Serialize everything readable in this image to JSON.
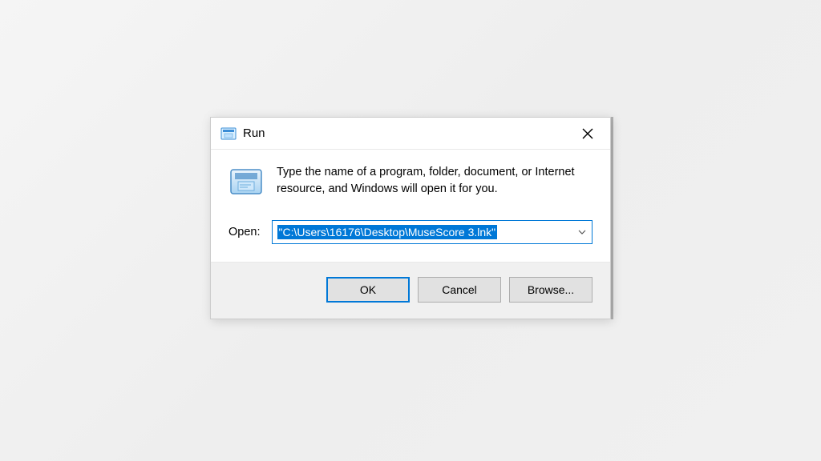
{
  "dialog": {
    "title": "Run",
    "description": "Type the name of a program, folder, document, or Internet resource, and Windows will open it for you.",
    "open_label": "Open:",
    "input_value": "\"C:\\Users\\16176\\Desktop\\MuseScore 3.lnk\"",
    "buttons": {
      "ok": "OK",
      "cancel": "Cancel",
      "browse": "Browse..."
    }
  }
}
